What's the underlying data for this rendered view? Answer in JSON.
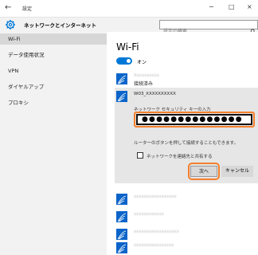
{
  "window": {
    "back_label": "←",
    "title": "設定",
    "minimize": "−",
    "maximize": "□",
    "close": "×"
  },
  "header": {
    "heading": "ネットワークとインターネット",
    "search_placeholder": "設定の検索"
  },
  "sidebar": {
    "items": [
      {
        "label": "Wi-Fi"
      },
      {
        "label": "データ使用状況"
      },
      {
        "label": "VPN"
      },
      {
        "label": "ダイヤルアップ"
      },
      {
        "label": "プロキシ"
      }
    ]
  },
  "main": {
    "title": "Wi-Fi",
    "toggle_label": "オン",
    "connected_status": "接続済み",
    "connected_name": "Xxxxxxxxxx",
    "expanded": {
      "network_name": "W03_XXXXXXXXXX",
      "security_label": "ネットワーク セキュリティ キーの入力",
      "password_mask": "●●●●●●●●●●●●●●",
      "wps_hint": "ルーターのボタンを押して接続することもできます。",
      "share_label": "ネットワークを連絡先と共有する",
      "next_label": "次へ",
      "cancel_label": "キャンセル"
    },
    "networks": [
      {
        "name": "xxxxxxxxxxxxxxxxx"
      },
      {
        "name": "xxxxxxxxxxxx"
      },
      {
        "name": "xxxxxxxxxxxxxxxxxx"
      },
      {
        "name": "xxxxxxxxxxxxxxxx"
      }
    ]
  },
  "colors": {
    "accent": "#0078d7",
    "highlight": "#f37f2b",
    "sidebar_bg": "#f2f2f2",
    "expanded_bg": "#e6e6e6"
  }
}
